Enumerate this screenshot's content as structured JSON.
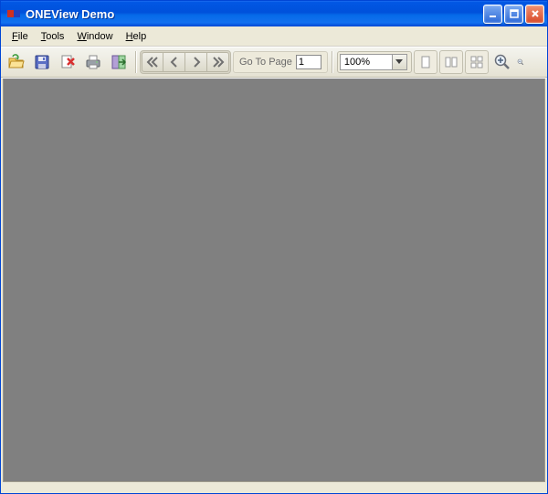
{
  "window": {
    "title": "ONEView Demo"
  },
  "menus": {
    "file": "File",
    "tools": "Tools",
    "window": "Window",
    "help": "Help"
  },
  "toolbar": {
    "goto_label": "Go To Page",
    "goto_value": "1",
    "zoom_value": "100%"
  }
}
